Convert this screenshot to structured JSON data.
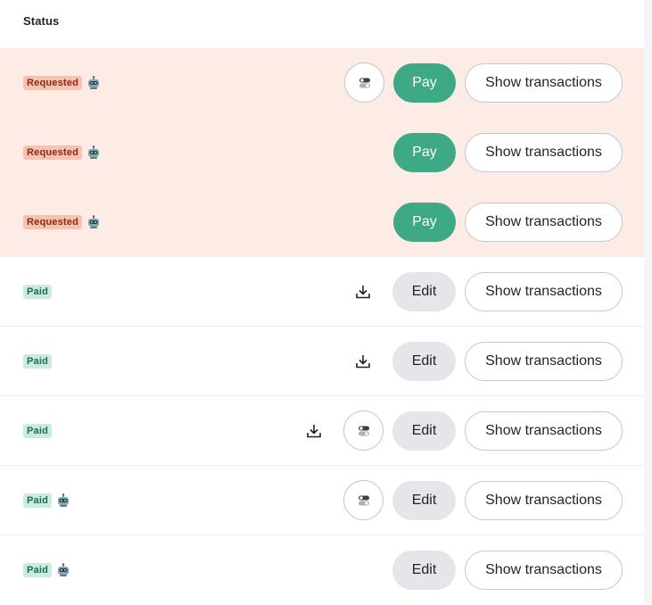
{
  "header": {
    "status_label": "Status"
  },
  "rows": [
    {
      "status": "Requested",
      "primary": "Pay",
      "secondary": "Show transactions"
    },
    {
      "status": "Requested",
      "primary": "Pay",
      "secondary": "Show transactions"
    },
    {
      "status": "Requested",
      "primary": "Pay",
      "secondary": "Show transactions"
    },
    {
      "status": "Paid",
      "primary": "Edit",
      "secondary": "Show transactions"
    },
    {
      "status": "Paid",
      "primary": "Edit",
      "secondary": "Show transactions"
    },
    {
      "status": "Paid",
      "primary": "Edit",
      "secondary": "Show transactions"
    },
    {
      "status": "Paid",
      "primary": "Edit",
      "secondary": "Show transactions"
    },
    {
      "status": "Paid",
      "primary": "Edit",
      "secondary": "Show transactions"
    }
  ],
  "colors": {
    "requested_row_bg": "#fdebe6",
    "requested_badge_bg": "#f8c2b1",
    "paid_badge_bg": "#c9ecdf",
    "pay_button": "#3daa85",
    "edit_button": "#e4e6e9"
  },
  "icons": [
    "robot-icon",
    "toggle-icon",
    "download-icon"
  ]
}
